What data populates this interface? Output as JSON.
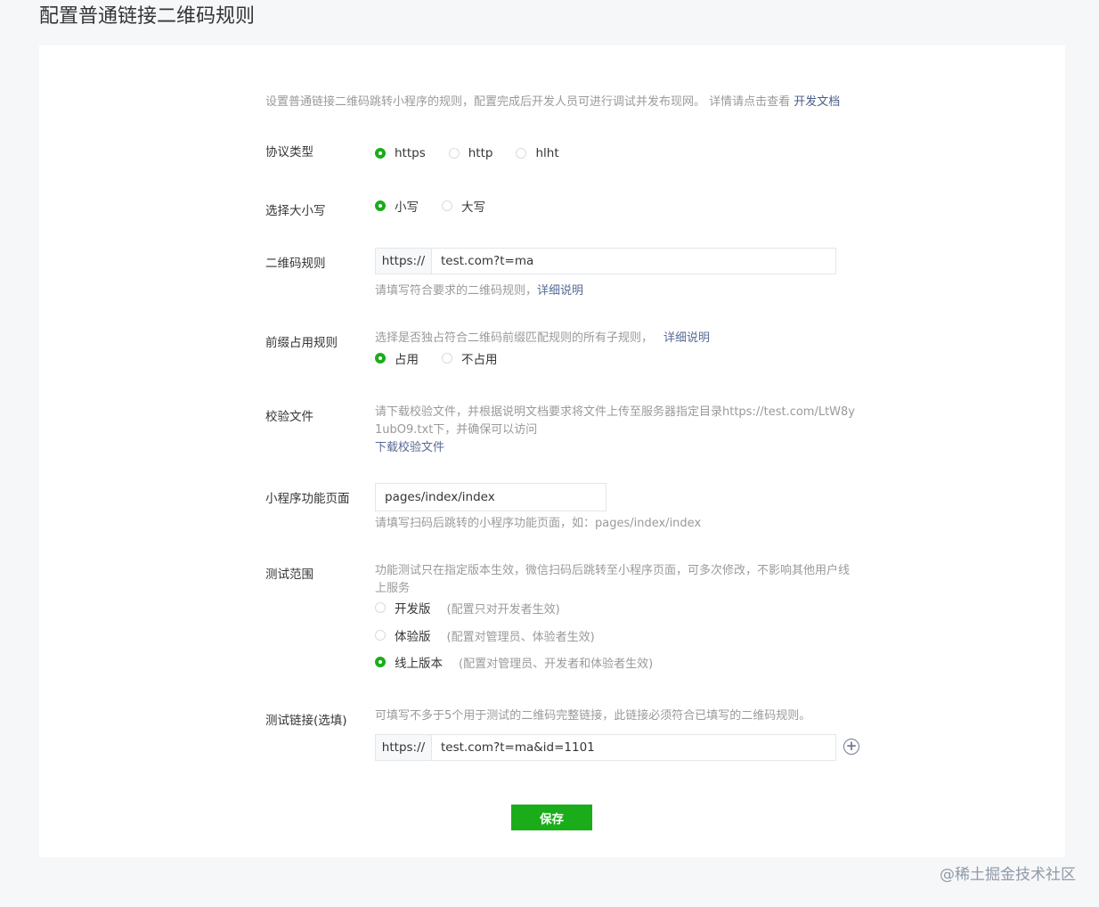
{
  "page_title": "配置普通链接二维码规则",
  "intro": {
    "text": "设置普通链接二维码跳转小程序的规则，配置完成后开发人员可进行调试并发布现网。 详情请点击查看 ",
    "link": "开发文档"
  },
  "protocol": {
    "label": "协议类型",
    "options": [
      "https",
      "http",
      "hlht"
    ],
    "selected": "https"
  },
  "case": {
    "label": "选择大小写",
    "options": [
      "小写",
      "大写"
    ],
    "selected": "小写"
  },
  "qr_rule": {
    "label": "二维码规则",
    "prefix": "https://",
    "value": "test.com?t=ma",
    "hint": "请填写符合要求的二维码规则，",
    "hint_link": "详细说明"
  },
  "prefix_rule": {
    "label": "前缀占用规则",
    "hint": "选择是否独占符合二维码前缀匹配规则的所有子规则，",
    "hint_link": "详细说明",
    "options": [
      "占用",
      "不占用"
    ],
    "selected": "占用"
  },
  "verify_file": {
    "label": "校验文件",
    "hint_line1": "请下载校验文件，并根据说明文档要求将文件上传至服务器指定目录https://test.com/LtW8y",
    "hint_line2": "1ubO9.txt下，并确保可以访问",
    "download_link": "下载校验文件"
  },
  "mini_page": {
    "label": "小程序功能页面",
    "value": "pages/index/index",
    "hint": "请填写扫码后跳转的小程序功能页面，如：pages/index/index"
  },
  "test_scope": {
    "label": "测试范围",
    "hint_line1": "功能测试只在指定版本生效，微信扫码后跳转至小程序页面，可多次修改，不影响其他用户线",
    "hint_line2": "上服务",
    "options": [
      {
        "label": "开发版",
        "note": "(配置只对开发者生效)",
        "selected": false
      },
      {
        "label": "体验版",
        "note": "(配置对管理员、体验者生效)",
        "selected": false
      },
      {
        "label": "线上版本",
        "note": "(配置对管理员、开发者和体验者生效)",
        "selected": true
      }
    ]
  },
  "test_link": {
    "label": "测试链接(选填)",
    "hint": "可填写不多于5个用于测试的二维码完整链接，此链接必须符合已填写的二维码规则。",
    "prefix": "https://",
    "value": "test.com?t=ma&id=1101",
    "add_icon": "plus-circle-icon"
  },
  "save_label": "保存",
  "watermark": "@稀土掘金技术社区",
  "colors": {
    "accent": "#1aad19",
    "link": "#576b95",
    "hint": "#9a9a9a",
    "background": "#f6f7f9"
  }
}
